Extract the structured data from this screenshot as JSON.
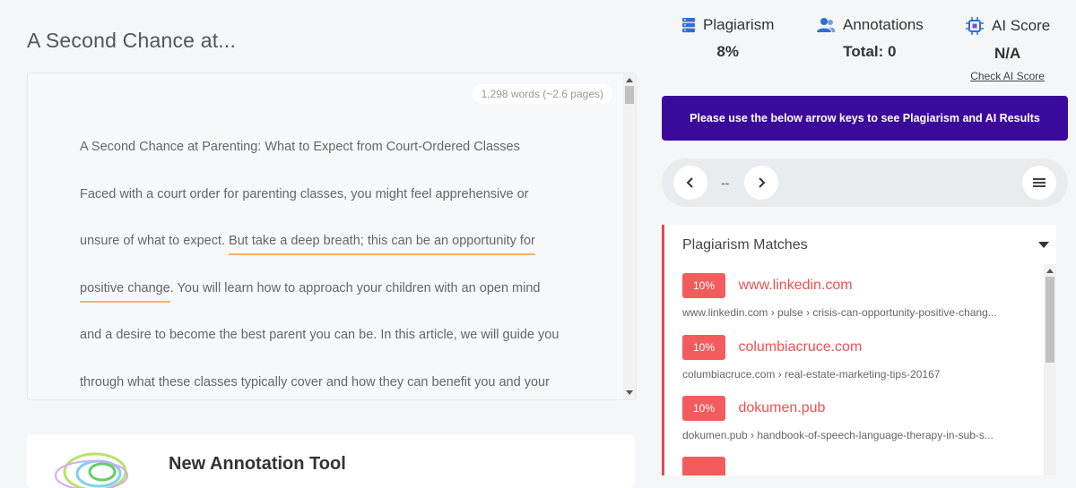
{
  "document": {
    "title": "A Second Chance at...",
    "word_count": "1,298 words (~2.6 pages)",
    "lines": [
      [
        "A Second Chance at Parenting: What to Expect from Court-Ordered Classes"
      ],
      [
        "Faced with a court order for parenting classes, you might feel apprehensive or"
      ],
      [
        "unsure of what to expect. ",
        "But take a deep breath; this can be an opportunity for"
      ],
      [
        "positive change",
        ". You will learn how to approach your children with an open mind"
      ],
      [
        "and a desire to become the best parent you can be. In this article, we will guide you"
      ],
      [
        "through what these classes typically cover and how they can benefit you and your"
      ]
    ]
  },
  "annotation_card": {
    "title": "New Annotation Tool"
  },
  "metrics": {
    "plagiarism": {
      "label": "Plagiarism",
      "value": "8%"
    },
    "annotations": {
      "label": "Annotations",
      "value": "Total: 0"
    },
    "ai_score": {
      "label": "AI Score",
      "value": "N/A",
      "link": "Check AI Score"
    }
  },
  "banner": {
    "text": "Please use the below arrow keys to see Plagiarism and AI Results"
  },
  "navigator": {
    "counter": "--"
  },
  "matches": {
    "title": "Plagiarism Matches",
    "items": [
      {
        "percent": "10%",
        "domain": "www.linkedin.com",
        "path": "www.linkedin.com › pulse › crisis-can-opportunity-positive-chang..."
      },
      {
        "percent": "10%",
        "domain": "columbiacruce.com",
        "path": "columbiacruce.com › real-estate-marketing-tips-20167"
      },
      {
        "percent": "10%",
        "domain": "dokumen.pub",
        "path": "dokumen.pub › handbook-of-speech-language-therapy-in-sub-s..."
      }
    ]
  },
  "colors": {
    "banner": "#3b0a9c",
    "match_badge": "#f25c5c",
    "match_accent": "#e04b4b",
    "highlight": "#f0b56a"
  },
  "icons": [
    "server-stack-icon",
    "users-icon",
    "ai-chip-icon",
    "chevron-left-icon",
    "chevron-right-icon",
    "hamburger-menu-icon",
    "caret-down-icon"
  ]
}
